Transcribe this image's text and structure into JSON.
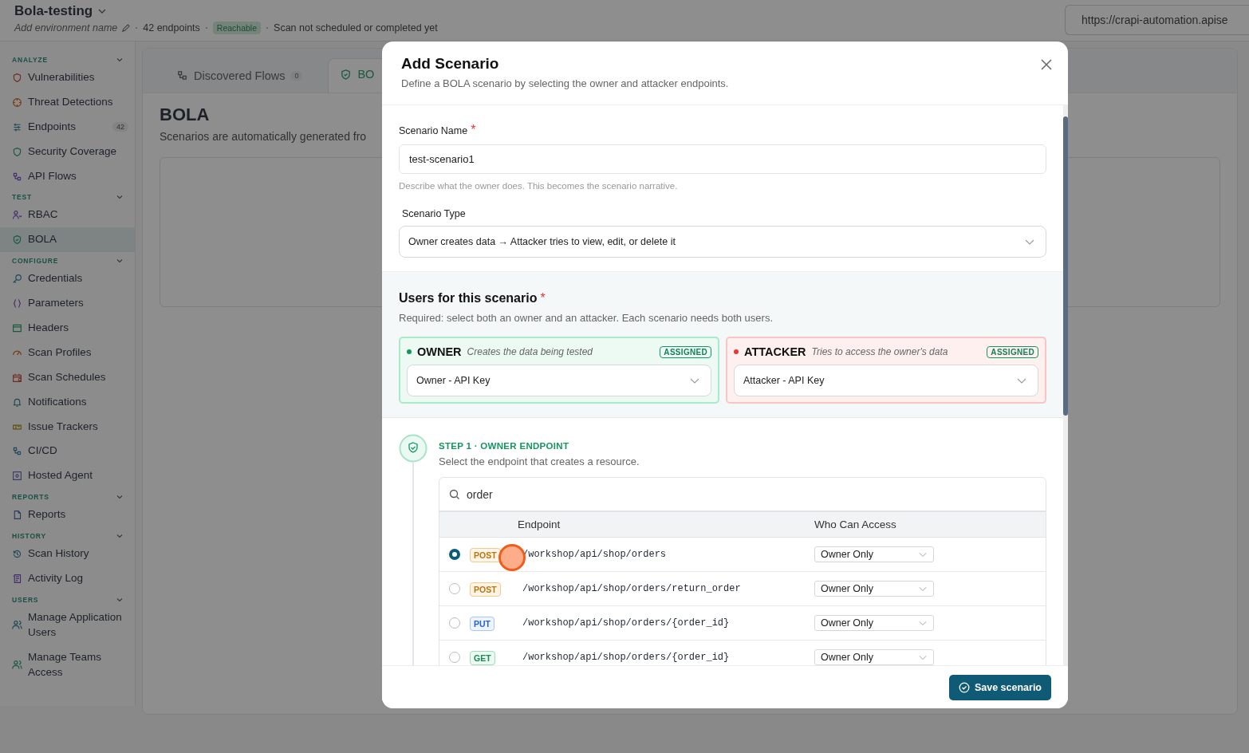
{
  "header": {
    "title": "Bola-testing",
    "env_placeholder": "Add environment name",
    "endpoints": "42 endpoints",
    "status": "Reachable",
    "scan_status": "Scan not scheduled or completed yet",
    "url": "https://crapi-automation.apise"
  },
  "sidebar": {
    "groups": [
      {
        "label": "ANALYZE",
        "expanded": true,
        "items": [
          {
            "label": "Vulnerabilities",
            "selected": false
          },
          {
            "label": "Threat Detections",
            "selected": false
          },
          {
            "label": "Endpoints",
            "selected": false,
            "count": "42"
          },
          {
            "label": "Security Coverage",
            "selected": false
          },
          {
            "label": "API Flows",
            "selected": false
          }
        ]
      },
      {
        "label": "TEST",
        "expanded": true,
        "items": [
          {
            "label": "RBAC",
            "selected": false
          },
          {
            "label": "BOLA",
            "selected": true
          }
        ]
      },
      {
        "label": "CONFIGURE",
        "expanded": true,
        "items": [
          {
            "label": "Credentials",
            "selected": false
          },
          {
            "label": "Parameters",
            "selected": false
          },
          {
            "label": "Headers",
            "selected": false
          },
          {
            "label": "Scan Profiles",
            "selected": false
          },
          {
            "label": "Scan Schedules",
            "selected": false
          },
          {
            "label": "Notifications",
            "selected": false
          },
          {
            "label": "Issue Trackers",
            "selected": false
          },
          {
            "label": "CI/CD",
            "selected": false
          },
          {
            "label": "Hosted Agent",
            "selected": false
          }
        ]
      },
      {
        "label": "REPORTS",
        "expanded": true,
        "items": [
          {
            "label": "Reports",
            "selected": false
          }
        ]
      },
      {
        "label": "HISTORY",
        "expanded": true,
        "items": [
          {
            "label": "Scan History",
            "selected": false
          },
          {
            "label": "Activity Log",
            "selected": false
          }
        ]
      },
      {
        "label": "USERS",
        "expanded": true,
        "items": [
          {
            "label": "Manage Application Users",
            "selected": false
          },
          {
            "label": "Manage Teams Access",
            "selected": false
          }
        ]
      }
    ]
  },
  "main": {
    "tabs": [
      {
        "label": "Discovered Flows",
        "count": "0",
        "selected": false
      },
      {
        "label": "BO",
        "selected": true
      }
    ],
    "title": "BOLA",
    "subtitle": "Scenarios are automatically generated fro"
  },
  "dialog": {
    "title": "Add Scenario",
    "subtitle": "Define a BOLA scenario by selecting the owner and attacker endpoints.",
    "name_label": "Scenario Name",
    "name_required_mark": "*",
    "name_value": "test-scenario1",
    "name_hint": "Describe what the owner does. This becomes the scenario narrative.",
    "type_label": "Scenario Type",
    "type_value": "Owner creates data → Attacker tries to view, edit, or delete it",
    "users": {
      "title": "Users for this scenario",
      "required_mark": "*",
      "hint": "Required: select both an owner and an attacker. Each scenario needs both users.",
      "cards": [
        {
          "kind": "owner",
          "role": "OWNER",
          "description": "Creates the data being tested",
          "badge": "ASSIGNED",
          "color": "#15965f",
          "value": "Owner - API Key"
        },
        {
          "kind": "attacker",
          "role": "ATTACKER",
          "description": "Tries to access the owner's data",
          "badge": "ASSIGNED",
          "color": "#e5383b",
          "value": "Attacker - API Key"
        }
      ]
    },
    "step": {
      "title": "STEP 1 · OWNER ENDPOINT",
      "hint": "Select the endpoint that creates a resource.",
      "search": "order",
      "columns": [
        "Endpoint",
        "Who Can Access"
      ],
      "rows": [
        {
          "selected": true,
          "method": "POST",
          "path": "/workshop/api/shop/orders",
          "access": "Owner Only"
        },
        {
          "selected": false,
          "method": "POST",
          "path": "/workshop/api/shop/orders/return_order",
          "access": "Owner Only"
        },
        {
          "selected": false,
          "method": "PUT",
          "path": "/workshop/api/shop/orders/{order_id}",
          "access": "Owner Only"
        },
        {
          "selected": false,
          "method": "GET",
          "path": "/workshop/api/shop/orders/{order_id}",
          "access": "Owner Only"
        }
      ]
    },
    "save": "Save scenario"
  }
}
